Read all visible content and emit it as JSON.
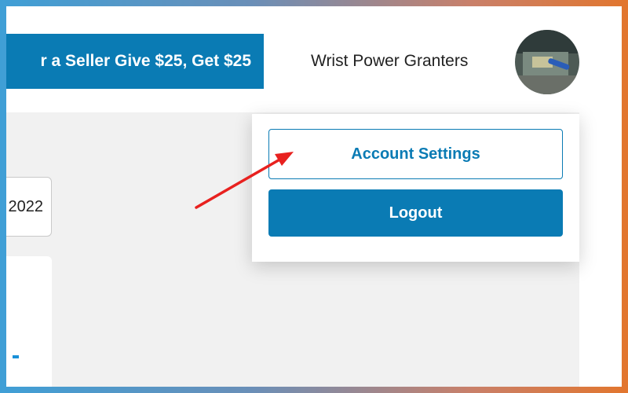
{
  "header": {
    "promo_text": "r a Seller Give $25, Get $25",
    "user_name": "Wrist Power Granters"
  },
  "dropdown": {
    "account_settings_label": "Account Settings",
    "logout_label": "Logout"
  },
  "content": {
    "date_fragment": "2022"
  },
  "colors": {
    "brand_blue": "#0a7bb4",
    "annotation_red": "#e8211f",
    "content_bg": "#f1f1f1"
  },
  "icons": {
    "avatar": "user-avatar-photo",
    "annotation": "red-arrow-icon"
  }
}
